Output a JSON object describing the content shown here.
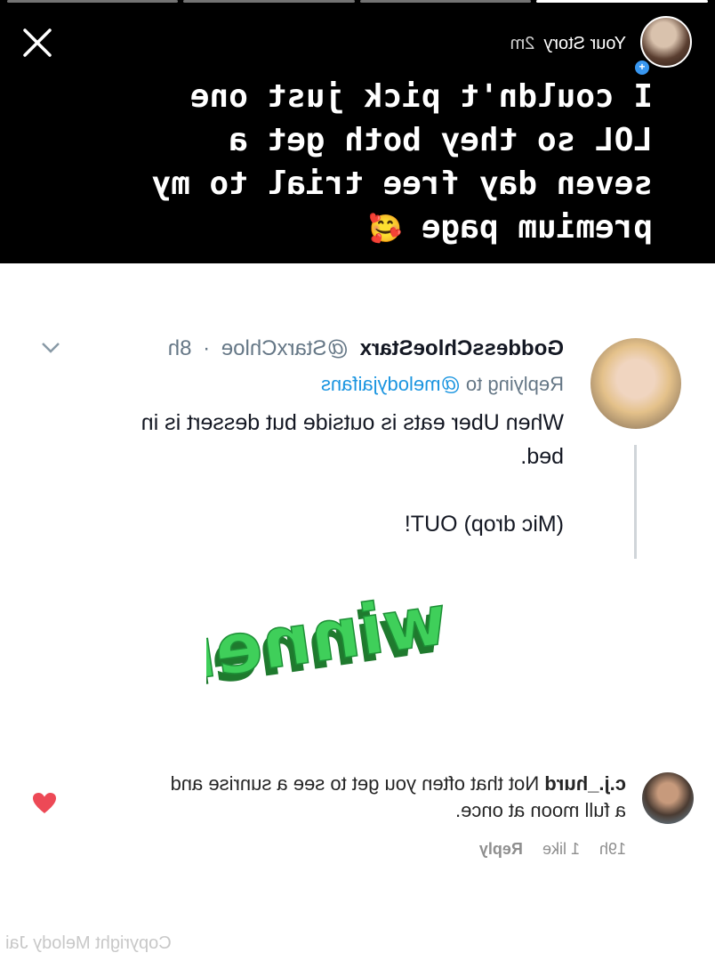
{
  "story": {
    "username": "Your Story",
    "time": "2m",
    "caption": "I couldn't pick just one\nLOL so they both get a\nseven day free trial to my\npremium page",
    "caption_emoji": "🥰",
    "segments_total": 4,
    "segments_done": 1
  },
  "tweet": {
    "display_name": "GoddessChloeStarx",
    "handle": "@StarxChloe",
    "separator": "·",
    "time": "8h",
    "replying_prefix": "Replying to",
    "replying_mention": "@melodyjaifans",
    "text": "When Uber eats is outside but dessert is in\nbed.\n\n(Mic drop) OUT!"
  },
  "sticker": {
    "text": "winner!"
  },
  "comment": {
    "username": "c.j._hurd",
    "text": "Not that often you get to see a sunrise and a full moon at once.",
    "time": "19h",
    "likes": "1 like",
    "reply_label": "Reply"
  },
  "footer": {
    "copyright": "Copyright Melody Jai"
  },
  "icons": {
    "close": "close-icon",
    "chevron": "chevron-down-icon",
    "heart": "heart-icon",
    "plus": "plus-icon"
  },
  "colors": {
    "story_bg": "#000000",
    "link": "#1b95e0",
    "heart": "#ed4956",
    "sticker_green": "#3fcf5a"
  }
}
